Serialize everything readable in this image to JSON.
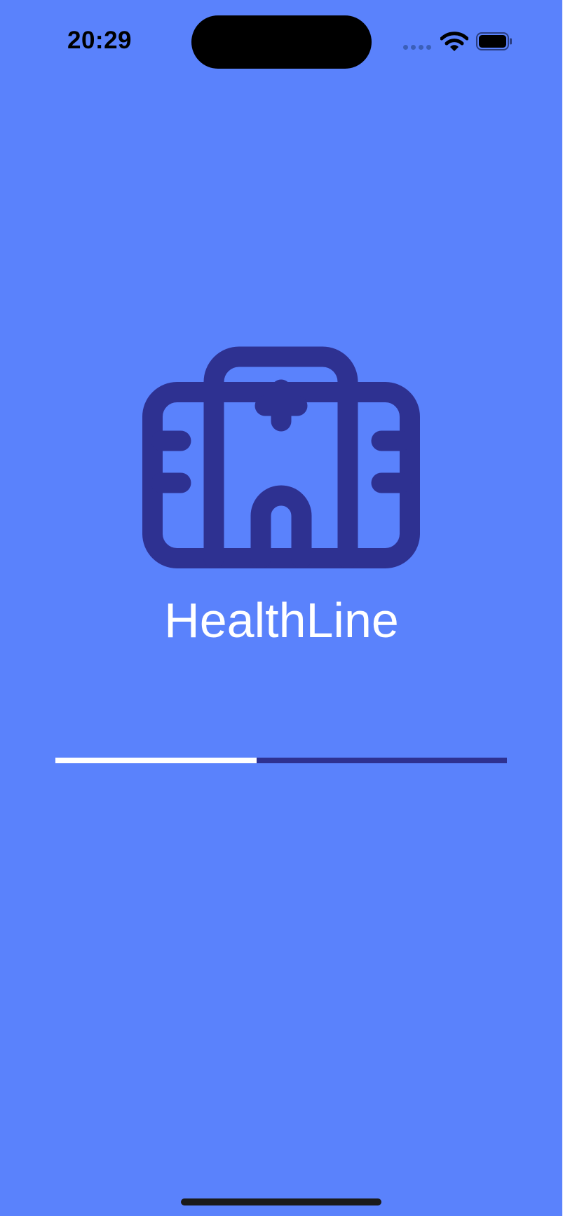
{
  "status_bar": {
    "time": "20:29",
    "icons": [
      "signal-dots-icon",
      "wifi-icon",
      "battery-icon"
    ]
  },
  "app": {
    "logo_icon": "hospital-icon",
    "title": "HealthLine"
  },
  "loading": {
    "progress": 0.445
  },
  "colors": {
    "background": "#5A82FC",
    "accent_dark": "#2E3191",
    "text": "#FFFFFF",
    "progress_fill": "#FFFFFF"
  }
}
